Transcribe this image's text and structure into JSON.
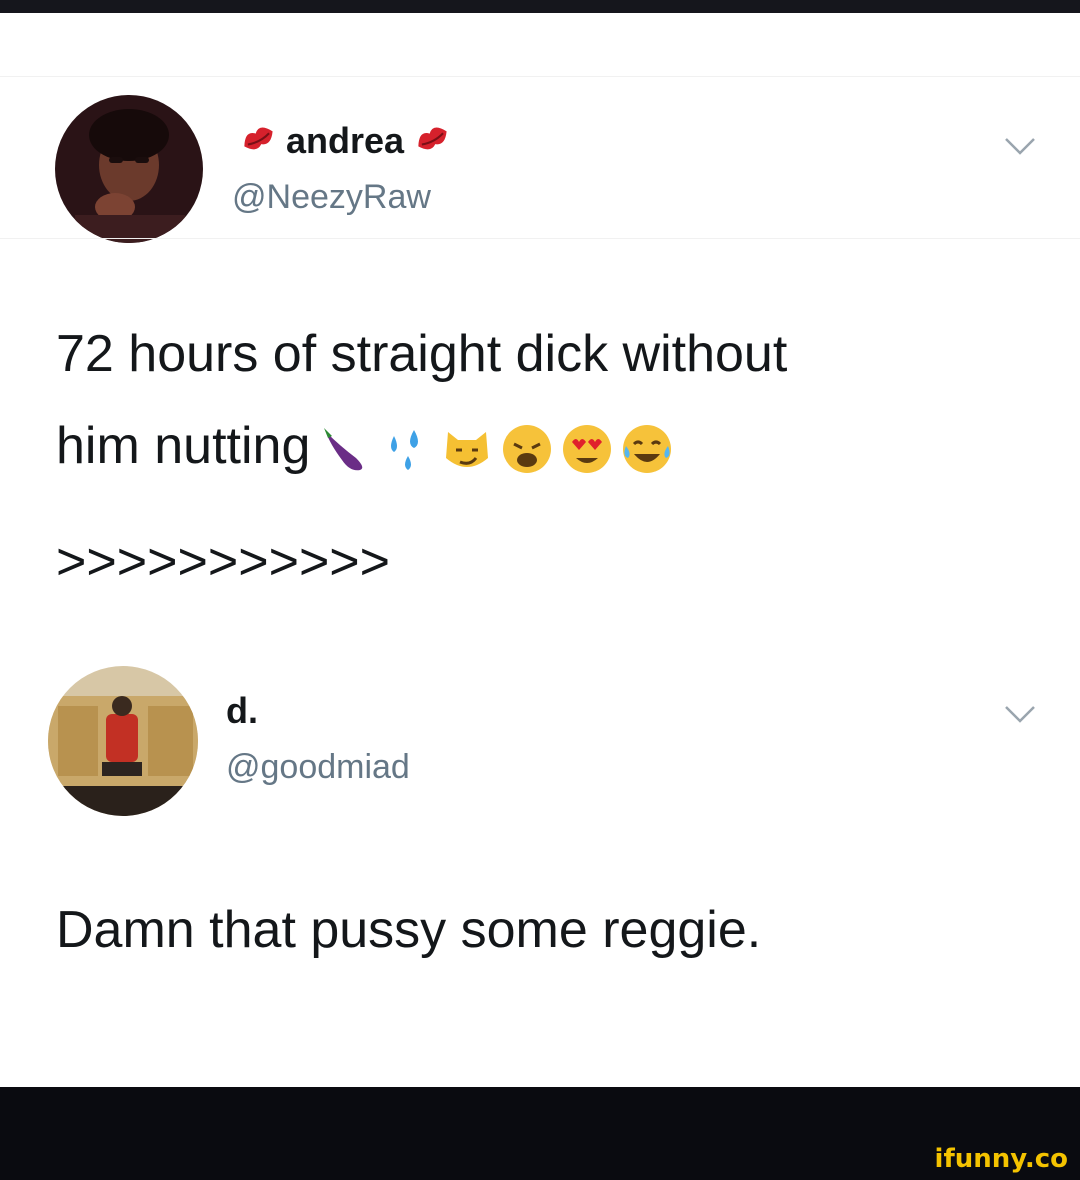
{
  "tweets": [
    {
      "display_name": "andrea",
      "handle": "@NeezyRaw",
      "text_line1": "72 hours of straight dick without",
      "text_line2": "him nutting",
      "text_line3": ">>>>>>>>>>>",
      "emoji": [
        "eggplant-emoji",
        "sweat-droplets-emoji",
        "smirk-cat-emoji",
        "weary-face-emoji",
        "heart-eyes-emoji",
        "tears-of-joy-emoji"
      ]
    },
    {
      "display_name": "d.",
      "handle": "@goodmiad",
      "text": "Damn that pussy some reggie."
    }
  ],
  "watermark": "ifunny.co",
  "colors": {
    "text": "#14171a",
    "handle": "#657786",
    "background": "#ffffff",
    "bottom_bar": "#0a0b10",
    "watermark": "#f4c300"
  }
}
